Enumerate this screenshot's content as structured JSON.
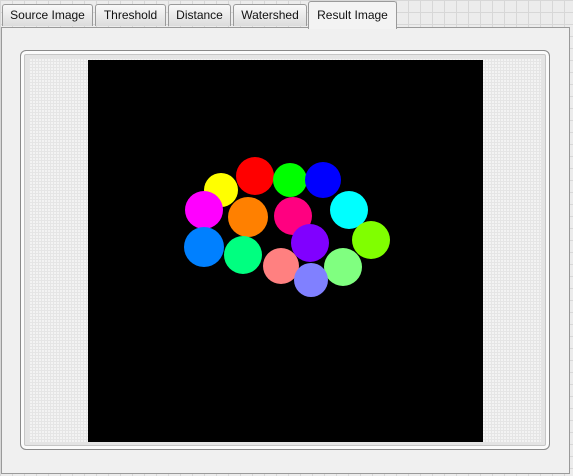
{
  "tabs": [
    {
      "label": "Source Image",
      "active": false
    },
    {
      "label": "Threshold",
      "active": false
    },
    {
      "label": "Distance",
      "active": false
    },
    {
      "label": "Watershed",
      "active": false
    },
    {
      "label": "Result Image",
      "active": true
    }
  ],
  "result_image": {
    "background_color": "#000000",
    "regions": [
      {
        "name": "red-region",
        "color": "#ff0000"
      },
      {
        "name": "green-region",
        "color": "#00ff00"
      },
      {
        "name": "blue-region",
        "color": "#0000ff"
      },
      {
        "name": "yellow-region",
        "color": "#ffff00"
      },
      {
        "name": "magenta-region",
        "color": "#ff00ff"
      },
      {
        "name": "orange-region",
        "color": "#ff8000"
      },
      {
        "name": "crimson-region",
        "color": "#ff0080"
      },
      {
        "name": "cyan-region",
        "color": "#00ffff"
      },
      {
        "name": "lime-region",
        "color": "#80ff00"
      },
      {
        "name": "azure-region",
        "color": "#0080ff"
      },
      {
        "name": "spring-green-region",
        "color": "#00ff80"
      },
      {
        "name": "violet-region",
        "color": "#8000ff"
      },
      {
        "name": "salmon-region",
        "color": "#ff8080"
      },
      {
        "name": "light-green-region",
        "color": "#80ff80"
      },
      {
        "name": "periwinkle-region",
        "color": "#8080ff"
      }
    ]
  }
}
